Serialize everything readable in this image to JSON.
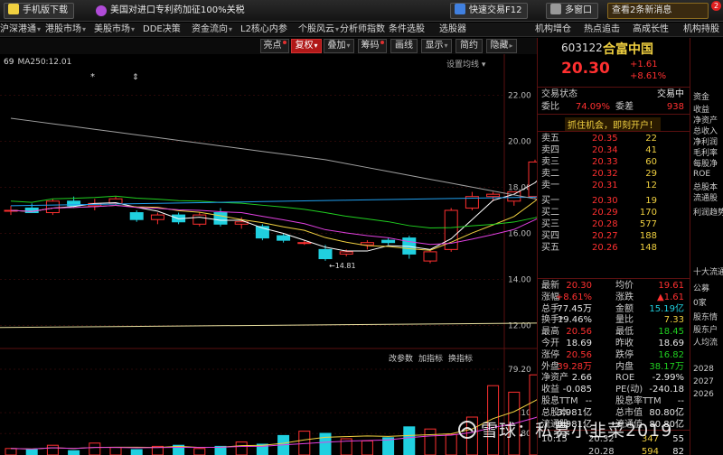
{
  "topbar": {
    "download_label": "手机版下载",
    "news": "美国对进口专利药加征100%关税",
    "quick_trade": "快速交易F12",
    "multi_window": "多窗口",
    "notifications": "查看2条新消息",
    "notif_count": "2"
  },
  "menu": [
    "沪深港通",
    "港股市场",
    "美股市场",
    "DDE决策",
    "资金流向",
    "L2核心内参",
    "个股风云",
    "分析师指数",
    "条件选股",
    "选股器",
    "机构增仓",
    "热点追击",
    "高成长性",
    "机构持股"
  ],
  "toolbar": {
    "buttons": [
      "亮点",
      "复权",
      "叠加",
      "筹码",
      "画线",
      "显示",
      "简约",
      "隐藏"
    ],
    "active": "复权"
  },
  "chart": {
    "ma_prefix": "69",
    "ma_label": "MA250:12.01",
    "settings_label": "设置均线",
    "sub_tabs": [
      "改参数",
      "加指标",
      "换指标"
    ],
    "marker_high": "20.56",
    "marker_low": "14.81",
    "star_marker": "*",
    "arrow_marker": "⇕"
  },
  "chart_data": [
    {
      "type": "candlestick",
      "title": "",
      "ylim": [
        11.0,
        23.0
      ],
      "y_ticks": [
        "22.00",
        "20.00",
        "18.00",
        "16.00",
        "14.00",
        "12.00"
      ],
      "ma_series": [
        {
          "name": "MA250",
          "value": 12.01
        }
      ],
      "annotations": [
        {
          "text": "20.56",
          "kind": "high"
        },
        {
          "text": "14.81",
          "kind": "low"
        }
      ],
      "candles": [
        {
          "o": 17.0,
          "h": 17.2,
          "l": 16.8,
          "c": 17.0
        },
        {
          "o": 17.1,
          "h": 17.3,
          "l": 16.9,
          "c": 16.9
        },
        {
          "o": 16.9,
          "h": 17.5,
          "l": 16.8,
          "c": 17.4
        },
        {
          "o": 17.4,
          "h": 17.6,
          "l": 17.1,
          "c": 17.2
        },
        {
          "o": 17.2,
          "h": 17.5,
          "l": 17.0,
          "c": 17.3
        },
        {
          "o": 17.3,
          "h": 17.6,
          "l": 17.2,
          "c": 17.5
        },
        {
          "o": 16.9,
          "h": 17.0,
          "l": 16.5,
          "c": 16.6
        },
        {
          "o": 16.6,
          "h": 16.9,
          "l": 16.4,
          "c": 16.8
        },
        {
          "o": 16.8,
          "h": 16.9,
          "l": 16.4,
          "c": 16.5
        },
        {
          "o": 16.4,
          "h": 16.9,
          "l": 16.3,
          "c": 16.8
        },
        {
          "o": 16.9,
          "h": 17.1,
          "l": 16.3,
          "c": 16.4
        },
        {
          "o": 16.4,
          "h": 16.7,
          "l": 16.2,
          "c": 16.5
        },
        {
          "o": 16.3,
          "h": 16.4,
          "l": 15.7,
          "c": 15.8
        },
        {
          "o": 15.9,
          "h": 16.0,
          "l": 15.6,
          "c": 15.7
        },
        {
          "o": 15.6,
          "h": 15.7,
          "l": 15.5,
          "c": 15.6
        },
        {
          "o": 15.3,
          "h": 15.5,
          "l": 14.81,
          "c": 14.9
        },
        {
          "o": 15.1,
          "h": 15.3,
          "l": 15.0,
          "c": 15.2
        },
        {
          "o": 15.5,
          "h": 15.7,
          "l": 15.3,
          "c": 15.6
        },
        {
          "o": 15.7,
          "h": 15.8,
          "l": 15.5,
          "c": 15.6
        },
        {
          "o": 15.8,
          "h": 15.9,
          "l": 14.9,
          "c": 15.1
        },
        {
          "o": 14.8,
          "h": 15.3,
          "l": 14.7,
          "c": 15.2
        },
        {
          "o": 15.3,
          "h": 17.1,
          "l": 15.2,
          "c": 17.0
        },
        {
          "o": 17.1,
          "h": 17.8,
          "l": 17.0,
          "c": 17.6
        },
        {
          "o": 17.6,
          "h": 17.8,
          "l": 17.4,
          "c": 17.7
        },
        {
          "o": 17.4,
          "h": 17.8,
          "l": 17.2,
          "c": 17.8
        },
        {
          "o": 17.6,
          "h": 19.2,
          "l": 17.5,
          "c": 19.1
        },
        {
          "o": 18.6,
          "h": 20.56,
          "l": 18.4,
          "c": 20.3
        }
      ]
    },
    {
      "type": "bar",
      "title": "",
      "ylim": [
        0,
        85
      ],
      "y_ticks": [
        "79.20",
        "39.10",
        "19.80"
      ],
      "values": [
        6,
        5,
        9,
        4,
        11,
        7,
        5,
        8,
        9,
        6,
        8,
        12,
        10,
        18,
        22,
        20,
        15,
        13,
        16,
        26,
        24,
        19,
        35,
        64,
        58,
        74,
        79
      ]
    }
  ],
  "quote": {
    "code": "603122",
    "name": "合富中国",
    "price": "20.30",
    "change": "+1.61",
    "change_pct": "+8.61%",
    "status_label": "交易状态",
    "status_value": "交易中",
    "weibi_label": "委比",
    "weibi_value": "74.09%",
    "weicha_label": "委差",
    "weicha_value": "938",
    "promo": "抓住机会，即刻开户！",
    "asks": [
      {
        "label": "卖五",
        "price": "20.35",
        "vol": "22"
      },
      {
        "label": "卖四",
        "price": "20.34",
        "vol": "41"
      },
      {
        "label": "卖三",
        "price": "20.33",
        "vol": "60"
      },
      {
        "label": "卖二",
        "price": "20.32",
        "vol": "29"
      },
      {
        "label": "卖一",
        "price": "20.31",
        "vol": "12"
      }
    ],
    "bids": [
      {
        "label": "买一",
        "price": "20.30",
        "vol": "19"
      },
      {
        "label": "买二",
        "price": "20.29",
        "vol": "170"
      },
      {
        "label": "买三",
        "price": "20.28",
        "vol": "577"
      },
      {
        "label": "买四",
        "price": "20.27",
        "vol": "188"
      },
      {
        "label": "买五",
        "price": "20.26",
        "vol": "148"
      }
    ],
    "stats": [
      {
        "l1": "最新",
        "v1": "20.30",
        "c1": "red",
        "l2": "均价",
        "v2": "19.61",
        "c2": "red"
      },
      {
        "l1": "涨幅",
        "v1": "+8.61%",
        "c1": "red",
        "l2": "涨跌",
        "v2": "▲1.61",
        "c2": "red"
      },
      {
        "l1": "总手",
        "v1": "77.45万",
        "c1": "white",
        "l2": "金额",
        "v2": "15.19亿",
        "c2": "cyan"
      },
      {
        "l1": "换手*",
        "v1": "19.46%",
        "c1": "white",
        "l2": "量比",
        "v2": "7.33",
        "c2": "yellow"
      },
      {
        "l1": "最高",
        "v1": "20.56",
        "c1": "red",
        "l2": "最低",
        "v2": "18.45",
        "c2": "green"
      },
      {
        "l1": "今开",
        "v1": "18.69",
        "c1": "white",
        "l2": "昨收",
        "v2": "18.69",
        "c2": "white"
      },
      {
        "l1": "涨停",
        "v1": "20.56",
        "c1": "red",
        "l2": "跌停",
        "v2": "16.82",
        "c2": "green"
      },
      {
        "l1": "外盘",
        "v1": "39.28万",
        "c1": "red",
        "l2": "内盘",
        "v2": "38.17万",
        "c2": "green"
      },
      {
        "l1": "净资产",
        "v1": "2.66",
        "c1": "white",
        "l2": "ROE",
        "v2": "-2.99%",
        "c2": "white"
      },
      {
        "l1": "收益",
        "v1": "-0.085",
        "c1": "white",
        "l2": "PE(动)",
        "v2": "-240.18",
        "c2": "white"
      },
      {
        "l1": "股息TTM",
        "v1": "--",
        "c1": "white",
        "l2": "股息率TTM",
        "v2": "--",
        "c2": "white"
      },
      {
        "l1": "总股本",
        "v1": "3.981亿",
        "c1": "white",
        "l2": "总市值",
        "v2": "80.80亿",
        "c2": "white"
      },
      {
        "l1": "流通股",
        "v1": "3.981亿",
        "c1": "white",
        "l2": "流通值",
        "v2": "80.80亿",
        "c2": "white"
      }
    ],
    "ticks": [
      {
        "time": "10:15",
        "price": "20.32",
        "vol": "347",
        "num": "55"
      },
      {
        "time": "",
        "price": "20.28",
        "vol": "594",
        "num": "82"
      }
    ]
  },
  "far_right": {
    "items": [
      "资金",
      "收益",
      "净资产",
      "总收入",
      "净利润",
      "毛利率",
      "每股净",
      "ROE",
      "总股本",
      "流通股",
      "利润趋势",
      "十大流通",
      "公募",
      "0家",
      "股东情",
      "股东户",
      "人均流",
      "2028",
      "2027",
      "2026"
    ]
  },
  "watermark": "雪球：私募小韭菜2019"
}
